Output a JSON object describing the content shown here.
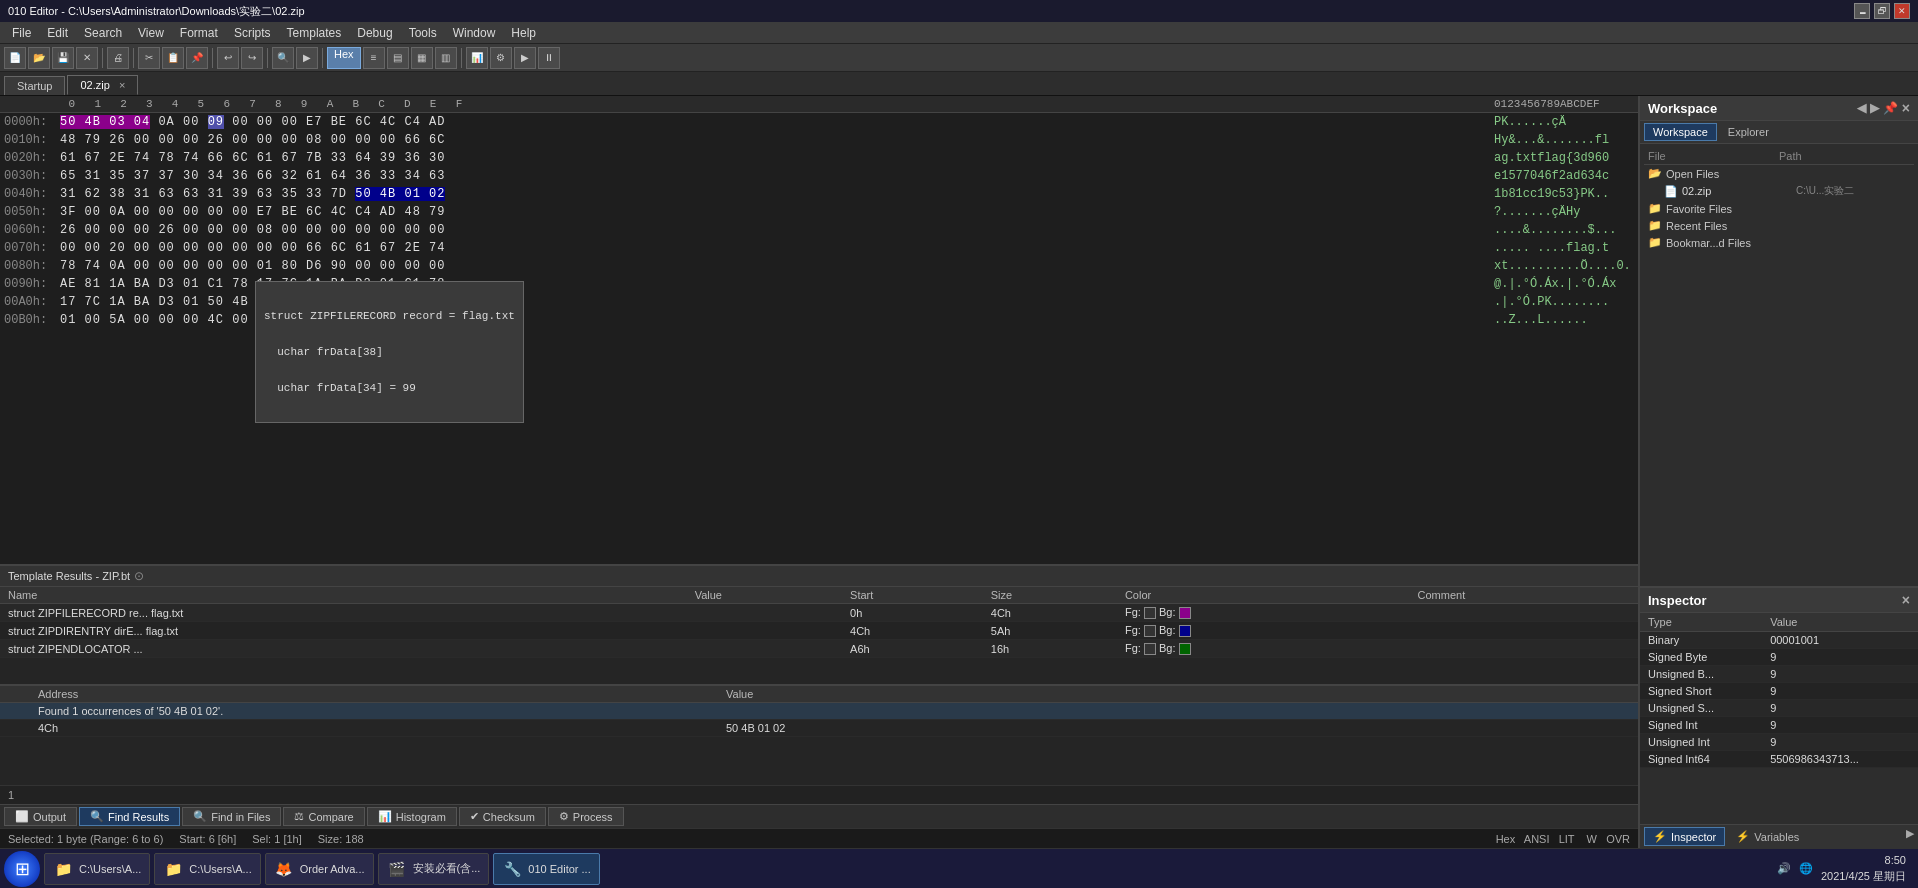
{
  "titlebar": {
    "title": "010 Editor - C:\\Users\\Administrator\\Downloads\\实验二\\02.zip",
    "minimize": "🗕",
    "maximize": "🗗",
    "close": "✕"
  },
  "menubar": {
    "items": [
      "File",
      "Edit",
      "Search",
      "View",
      "Format",
      "Scripts",
      "Templates",
      "Debug",
      "Tools",
      "Window",
      "Help"
    ]
  },
  "tabs": {
    "startup": "Startup",
    "file": "02.zip",
    "file_close": "×"
  },
  "hex_editor": {
    "col_header": "  0  1  2  3  4  5  6  7  8  9  A  B  C  D  E  F  0123456789ABCDEF",
    "rows": [
      {
        "offset": "0000h:",
        "bytes": "50 4B 03 04 0A 00 09 00 00 00 E7 BE 6C 4C C4 AD",
        "ascii": "PK.......çÄ­"
      },
      {
        "offset": "0010h:",
        "bytes": "48 79 26 00 00 00 26 00 00 00 08 00 00 00 66 6C",
        "ascii": "Hy&...&.....fl"
      },
      {
        "offset": "0020h:",
        "bytes": "61 67 2E 74 78 74 66 6C 61 67 7B 33 64 39 36 30",
        "ascii": "ag.txtflag{3d960"
      },
      {
        "offset": "0030h:",
        "bytes": "65 31 35 37 37 30 34 36 66 32 61 64 36 33 34 63",
        "ascii": "e1577046f2ad634c"
      },
      {
        "offset": "0040h:",
        "bytes": "31 62 38 31 63 63 31 39 63 35 33 7D 50 4B 01 02",
        "ascii": "1b81cc19c53}PK.."
      },
      {
        "offset": "0050h:",
        "bytes": "3F 00 0A 00 00 00 00 00 E7 BE 6C 4C C4 AD 48 79",
        "ascii": "?......çÄ­Hy"
      },
      {
        "offset": "0060h:",
        "bytes": "26 00 00 00 26 00 00 00 08 00 00 00 00 00 00 00",
        "ascii": "....&........$...."
      },
      {
        "offset": "0070h:",
        "bytes": "00 00 20 00 00 00 00 00 00 00 66 6C 61 67 2E 74",
        "ascii": "......flag.t"
      },
      {
        "offset": "0080h:",
        "bytes": "78 74 0A 00 00 00 00 00 01 80 D6 90 00 00 00 00",
        "ascii": "xt..........Ö.....0."
      },
      {
        "offset": "0090h:",
        "bytes": "AE 81 1A BA D3 01 C1 78 17 7C 1A BA D3 01 C1 78",
        "ascii": "@.|.°Ó.Áx.|.°Ó.Áx"
      },
      {
        "offset": "00A0h:",
        "bytes": "17 7C 1A BA D3 01 50 4B 05 06 00 00 00 01 00 00",
        "ascii": ".|.°Ó.PK........"
      },
      {
        "offset": "00B0h:",
        "bytes": "01 00 5A 00 00 00 4C 00 00 00 00 00",
        "ascii": "..Z...L......"
      }
    ]
  },
  "tooltip": {
    "line1": "struct ZIPFILERECORD record = flag.txt",
    "line2": "  uchar frData[38]",
    "line3": "  uchar frData[34] = 99"
  },
  "template_results": {
    "title": "Template Results - ZIP.bt",
    "headers": [
      "Name",
      "Value",
      "Start",
      "Size",
      "Color",
      "Comment"
    ],
    "rows": [
      {
        "name": "struct ZIPFILERECORD re... flag.txt",
        "value": "",
        "start": "0h",
        "size": "4Ch",
        "fg": "Fg:",
        "bg": "Bg:",
        "comment": ""
      },
      {
        "name": "struct ZIPDIRENTRY dirE... flag.txt",
        "value": "",
        "start": "4Ch",
        "size": "5Ah",
        "fg": "Fg:",
        "bg": "Bg:",
        "comment": ""
      },
      {
        "name": "struct ZIPENDLOCATOR ...",
        "value": "",
        "start": "A6h",
        "size": "16h",
        "fg": "Fg:",
        "bg": "Bg:",
        "comment": ""
      }
    ]
  },
  "find_results": {
    "title": "Find Results",
    "headers": [
      "Address",
      "Value"
    ],
    "message": "Found 1 occurrences of '50 4B 01 02'.",
    "rows": [
      {
        "address": "4Ch",
        "value": "50 4B 01 02"
      }
    ],
    "count": "1"
  },
  "bottom_tabs": {
    "items": [
      "Output",
      "Find Results",
      "Find in Files",
      "Compare",
      "Histogram",
      "Checksum",
      "Process"
    ]
  },
  "status_bar": {
    "selected": "Selected: 1 byte (Range: 6 to 6)",
    "start": "Start: 6 [6h]",
    "sel": "Sel: 1 [1h]",
    "size": "Size: 188",
    "hex": "Hex",
    "ansi": "ANSI",
    "lit": "LIT",
    "w": "W",
    "ovr": "OVR"
  },
  "workspace": {
    "title": "Workspace",
    "nav_prev": "◀",
    "nav_next": "▶",
    "pin": "📌",
    "close": "×",
    "tabs": [
      "Workspace",
      "Explorer"
    ],
    "col_file": "File",
    "col_path": "Path",
    "open_files_label": "Open Files",
    "open_file_name": "02.zip",
    "open_file_path": "C:\\U...实验二",
    "favorite_files_label": "Favorite Files",
    "recent_files_label": "Recent Files",
    "bookmark_files_label": "Bookmar...d Files"
  },
  "inspector": {
    "title": "Inspector",
    "close": "×",
    "headers": [
      "Type",
      "Value"
    ],
    "rows": [
      {
        "type": "Binary",
        "value": "00001001"
      },
      {
        "type": "Signed Byte",
        "value": "9"
      },
      {
        "type": "Unsigned B...",
        "value": "9"
      },
      {
        "type": "Signed Short",
        "value": "9"
      },
      {
        "type": "Unsigned S...",
        "value": "9"
      },
      {
        "type": "Signed Int",
        "value": "9"
      },
      {
        "type": "Unsigned Int",
        "value": "9"
      },
      {
        "type": "Signed Int64",
        "value": "5506986343713..."
      }
    ],
    "bottom_tabs": [
      "Inspector",
      "Variables"
    ],
    "bottom_next": "▶"
  },
  "taskbar": {
    "start_icon": "⊞",
    "items": [
      {
        "icon": "📁",
        "label": "C:\\Users\\A..."
      },
      {
        "icon": "📁",
        "label": "C:\\Users\\A..."
      },
      {
        "icon": "🦊",
        "label": "Order Adva..."
      },
      {
        "icon": "🎬",
        "label": "安装必看(含..."
      },
      {
        "icon": "🔧",
        "label": "010 Editor ..."
      }
    ],
    "time": "8:50",
    "date": "2021/4/25 星期日",
    "volume": "🔊",
    "network": "🌐"
  }
}
